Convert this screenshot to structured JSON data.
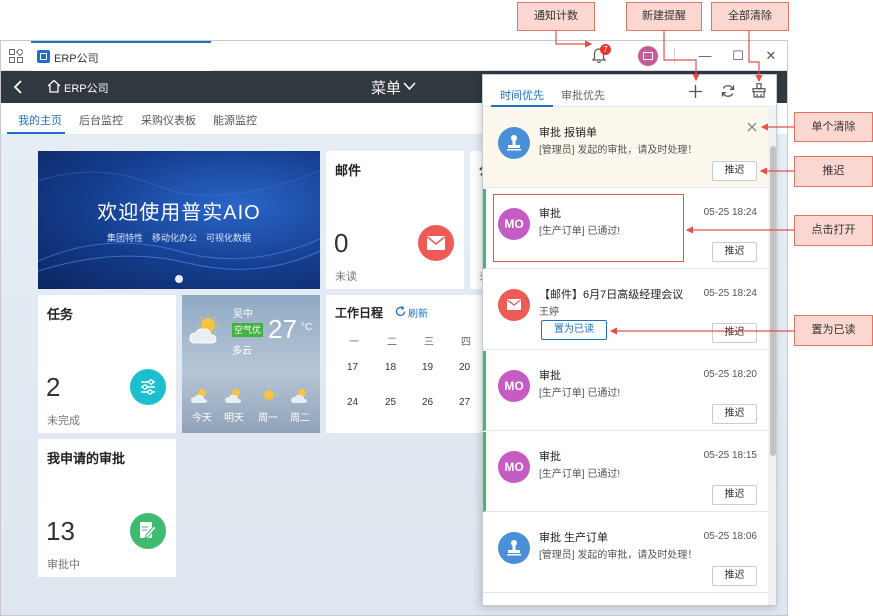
{
  "window": {
    "tab_label": "ERP公司",
    "notification_count": "7"
  },
  "appbar": {
    "title": "ERP公司",
    "menu": "菜单"
  },
  "nav_tabs": [
    "我的主页",
    "后台监控",
    "采购仪表板",
    "能源监控"
  ],
  "dashboard": {
    "banner": {
      "title": "欢迎使用普实AIO",
      "subtitle": "集团特性　移动化办公　可视化数据"
    },
    "mail": {
      "title": "邮件",
      "count": "0",
      "status": "未读"
    },
    "task": {
      "title": "任务",
      "count": "2",
      "status": "未完成"
    },
    "weather": {
      "city": "吴中",
      "aqi": "空气优",
      "temp": "27",
      "unit": "°C",
      "condition": "多云",
      "days": [
        "今天",
        "明天",
        "周一",
        "周二"
      ]
    },
    "schedule": {
      "title": "工作日程",
      "refresh": "刷新",
      "weekdays": [
        "一",
        "二",
        "三",
        "四"
      ],
      "row1": [
        "17",
        "18",
        "19",
        "20"
      ],
      "row2": [
        "24",
        "25",
        "26",
        "27"
      ]
    },
    "approval": {
      "title": "我申请的审批",
      "count": "13",
      "status": "审批中"
    },
    "partial_card_title": "公",
    "partial_card_status": "未"
  },
  "panel": {
    "tabs": [
      "时间优先",
      "审批优先"
    ],
    "items": [
      {
        "title": "审批 报销单",
        "desc": "[管理员] 发起的审批，请及时处理！",
        "time": "",
        "button": "推迟",
        "avatar": "stamp",
        "color": "#4a8fd8"
      },
      {
        "title": "审批",
        "desc": "[生产订单] 已通过!",
        "time": "05-25 18:24",
        "button": "推迟",
        "avatar": "MO",
        "color": "#c45cc4"
      },
      {
        "title": "【邮件】6月7日高级经理会议",
        "desc": "王婷",
        "time": "05-25 18:24",
        "button": "推迟",
        "read_button": "置为已读",
        "avatar": "mail",
        "color": "#ee5b56"
      },
      {
        "title": "审批",
        "desc": "[生产订单] 已通过!",
        "time": "05-25 18:20",
        "button": "推迟",
        "avatar": "MO",
        "color": "#c45cc4"
      },
      {
        "title": "审批",
        "desc": "[生产订单] 已通过!",
        "time": "05-25 18:15",
        "button": "推迟",
        "avatar": "MO",
        "color": "#c45cc4"
      },
      {
        "title": "审批 生产订单",
        "desc": "[管理员] 发起的审批，请及时处理！",
        "time": "05-25 18:06",
        "button": "推迟",
        "avatar": "stamp",
        "color": "#4a8fd8"
      }
    ]
  },
  "callouts": {
    "notify_count": "通知计数",
    "new_reminder": "新建提醒",
    "clear_all": "全部清除",
    "single_clear": "单个清除",
    "defer": "推迟",
    "click_open": "点击打开",
    "mark_read": "置为已读"
  },
  "colors": {
    "accent": "#1e6fc7",
    "header": "#313840",
    "callout_line": "#e3514a",
    "green": "#3dbb6f"
  }
}
